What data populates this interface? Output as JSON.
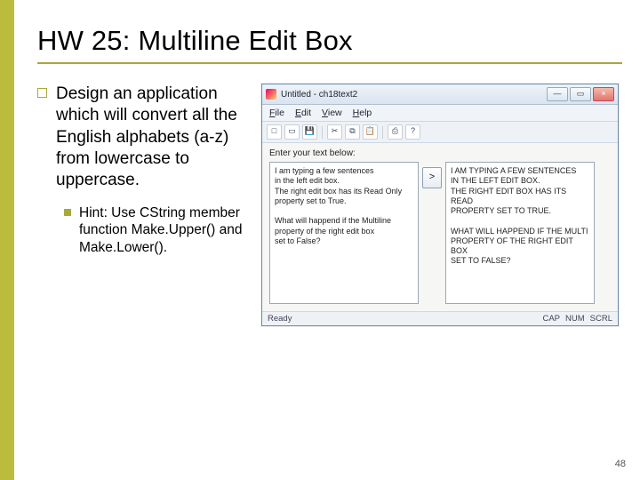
{
  "slide": {
    "title": "HW 25: Multiline Edit Box",
    "bullet1": "Design an application which will convert all the English alphabets (a-z) from lowercase to uppercase.",
    "bullet2": "Hint: Use CString member function Make.Upper() and Make.Lower().",
    "page_number": "48"
  },
  "app": {
    "window_title": "Untitled - ch18text2",
    "menu": {
      "file": "File",
      "edit": "Edit",
      "view": "View",
      "help": "Help"
    },
    "toolbar": {
      "new": "□",
      "open": "▭",
      "save": "💾",
      "cut": "✂",
      "copy": "⧉",
      "paste": "📋",
      "print": "⎙",
      "help": "?"
    },
    "prompt": "Enter your text below:",
    "left_text": "I am typing a few sentences\nin the left edit box.\nThe right edit box has its Read Only\nproperty set to True.\n\nWhat will happend if the Multiline\nproperty of the right edit box\nset to False?",
    "right_text": "I AM TYPING A FEW SENTENCES\nIN THE LEFT EDIT BOX.\nTHE RIGHT EDIT BOX HAS ITS READ\nPROPERTY SET TO TRUE.\n\nWHAT WILL HAPPEND IF THE MULTI\nPROPERTY OF THE RIGHT EDIT BOX\nSET TO FALSE?",
    "convert_label": ">",
    "status_left": "Ready",
    "status_right": {
      "cap": "CAP",
      "num": "NUM",
      "scrl": "SCRL"
    },
    "win_btns": {
      "min": "—",
      "max": "▭",
      "close": "×"
    }
  }
}
